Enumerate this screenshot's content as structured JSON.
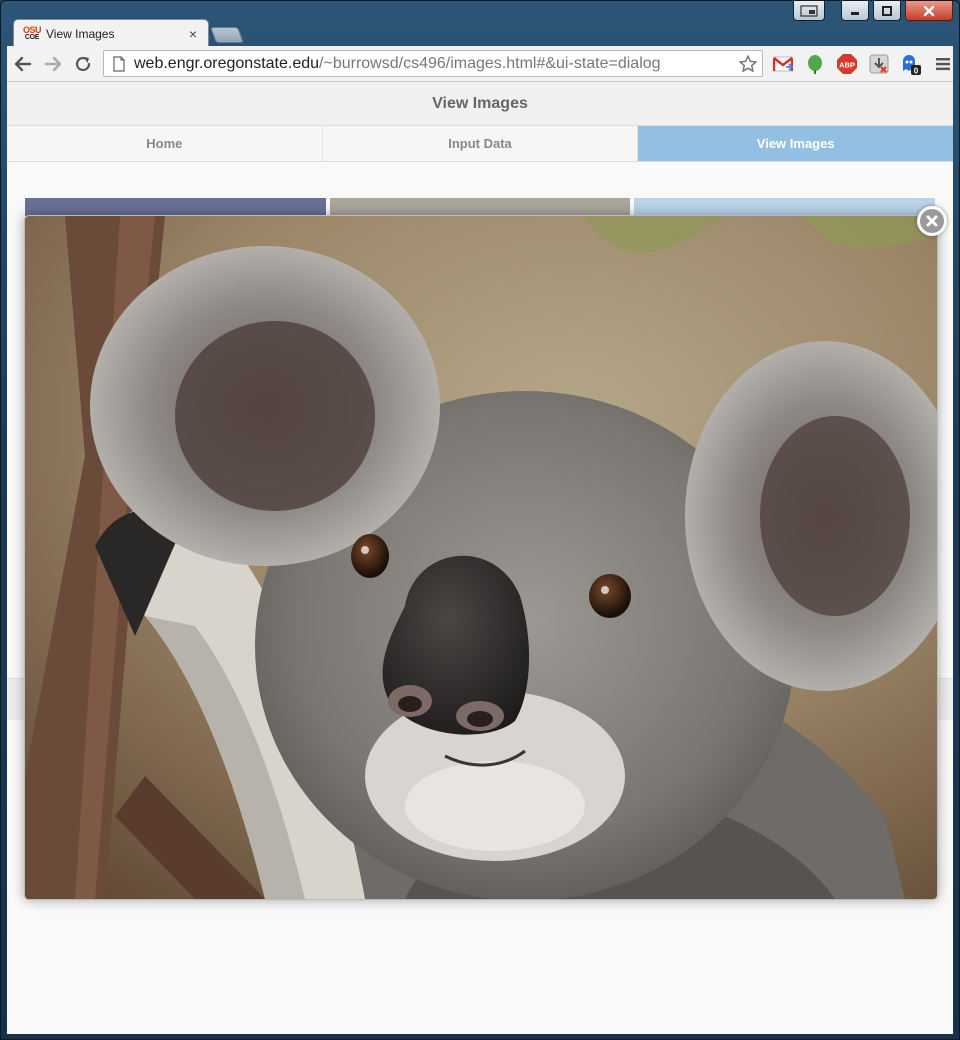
{
  "browser": {
    "tab": {
      "title": "View Images",
      "favicon_top": "OSU",
      "favicon_bottom": "COE",
      "close_glyph": "×"
    },
    "url": {
      "host": "web.engr.oregonstate.edu",
      "path": "/~burrowsd/cs496/images.html#&ui-state=dialog"
    },
    "extensions": [
      "gmail-icon",
      "evernote-icon",
      "adblock-icon",
      "download-icon",
      "ghostery-icon",
      "menu-icon"
    ],
    "extension_badges": {
      "ghostery": "0",
      "adblock": "ABP"
    }
  },
  "page": {
    "header_title": "View Images",
    "nav": [
      {
        "label": "Home",
        "active": false
      },
      {
        "label": "Input Data",
        "active": false
      },
      {
        "label": "View Images",
        "active": true
      }
    ]
  },
  "dialog": {
    "image_subject": "koala",
    "close_label": "close dialog"
  },
  "colors": {
    "active_tab": "#93bfe3",
    "window_frame": "#2c5577"
  }
}
